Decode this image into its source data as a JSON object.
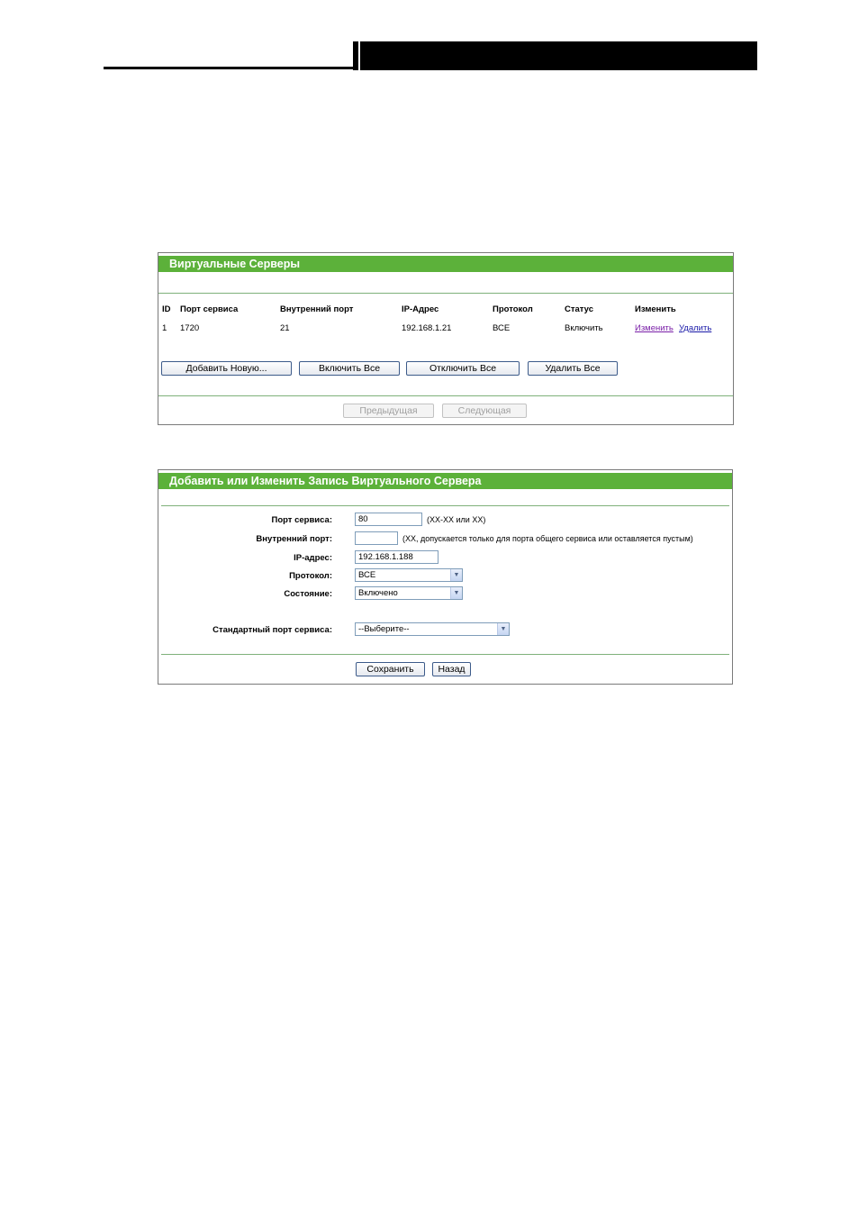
{
  "virtual_servers": {
    "title": "Виртуальные Серверы",
    "columns": [
      "ID",
      "Порт сервиса",
      "Внутренний порт",
      "IP-Адрес",
      "Протокол",
      "Статус",
      "Изменить"
    ],
    "rows": [
      {
        "id": "1",
        "service_port": "1720",
        "internal_port": "21",
        "ip": "192.168.1.21",
        "protocol": "ВСЕ",
        "status": "Включить",
        "edit_label": "Изменить",
        "delete_label": "Удалить"
      }
    ],
    "buttons": {
      "add_new": "Добавить Новую...",
      "enable_all": "Включить Все",
      "disable_all": "Отключить  Все",
      "delete_all": "Удалить Все"
    },
    "pagination": {
      "prev": "Предыдущая",
      "next": "Следующая"
    }
  },
  "edit_form": {
    "title": "Добавить или Изменить Запись Виртуального Сервера",
    "service_port": {
      "label": "Порт сервиса:",
      "value": "80",
      "hint": "(XX-XX или XX)"
    },
    "internal_port": {
      "label": "Внутренний порт:",
      "value": "",
      "hint": "(XX, допускается только для порта общего сервиса или оставляется пустым)"
    },
    "ip_address": {
      "label": "IP-адрес:",
      "value": "192.168.1.188"
    },
    "protocol": {
      "label": "Протокол:",
      "value": "ВСЕ"
    },
    "state": {
      "label": "Состояние:",
      "value": "Включено"
    },
    "standard_port": {
      "label": "Стандартный порт сервиса:",
      "value": "--Выберите--"
    },
    "buttons": {
      "save": "Сохранить",
      "back": "Назад"
    }
  },
  "colors": {
    "accent": "#5cb13a",
    "divider": "#7fb17a",
    "border": "#7a7a7a"
  }
}
